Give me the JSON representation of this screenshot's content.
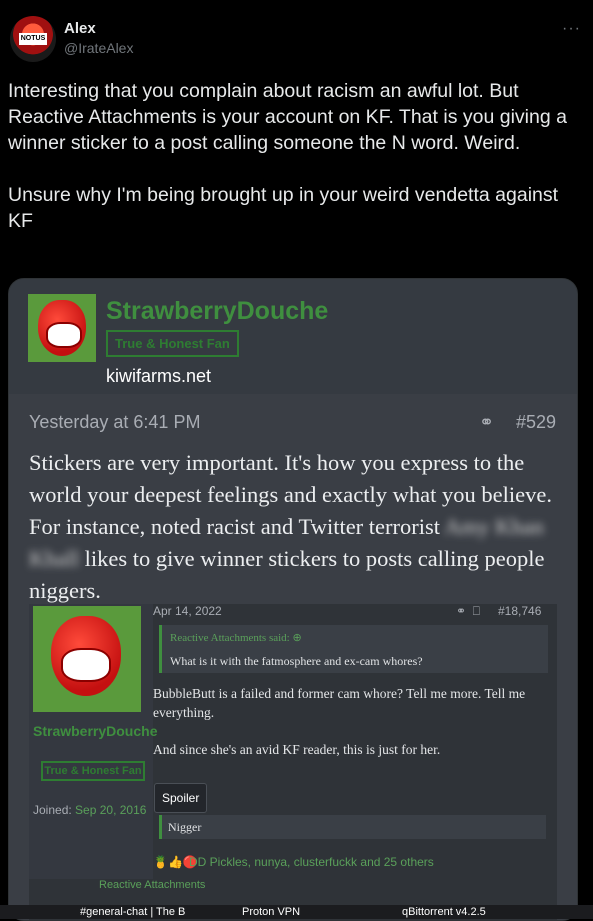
{
  "tweet": {
    "author_name": "Alex",
    "author_handle": "@IrateAlex",
    "avatar_text": "NOTUS",
    "more": "···",
    "paragraphs": [
      "Interesting that you complain about racism an awful lot. But Reactive Attachments is your account on KF. That is you giving a winner sticker to a post calling someone the N word. Weird.",
      "Unsure why I'm being brought up in your weird vendetta against KF"
    ]
  },
  "post": {
    "username": "StrawberryDouche",
    "badge": "True & Honest Fan",
    "site": "kiwifarms.net",
    "timestamp": "Yesterday at 6:41 PM",
    "post_number": "#529",
    "body_before": "Stickers are very important. It's how you express to the world your deepest feelings and exactly what you believe. For instance, noted racist and Twitter terrorist",
    "blurred_name": "Amy Khan Khall",
    "body_after": "likes to give winner stickers to posts calling people niggers."
  },
  "inner": {
    "username": "StrawberryDouche",
    "badge": "True & Honest Fan",
    "joined_label": "Joined:",
    "joined_date": "Sep 20, 2016",
    "date": "Apr 14, 2022",
    "post_number": "#18,746",
    "quote_attr": "Reactive Attachments said: ⊕",
    "quote_text": "What is it with the fatmosphere and ex-cam whores?",
    "body": [
      "BubbleButt is a failed and former cam whore? Tell me more. Tell me everything.",
      "And since she's an avid KF reader, this is just for her."
    ],
    "spoiler_label": "Spoiler",
    "spoiler_text": "Nigger",
    "reactions": "DD Pickles, nunya, clusterfuckk and 25 others",
    "next_user": "Reactive Attachments"
  },
  "taskbar": {
    "items": [
      "#general-chat | The B",
      "Proton VPN",
      "qBittorrent v4.2.5"
    ]
  },
  "colors": {
    "background": "#000000",
    "accent_green": "#3f8f3f",
    "card": "#3a3e45"
  }
}
